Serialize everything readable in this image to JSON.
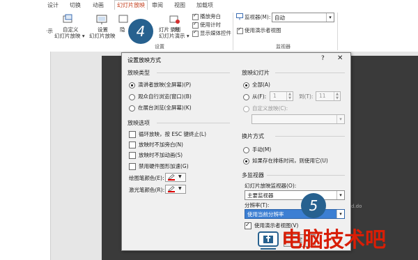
{
  "ribbon": {
    "tabs": [
      "设计",
      "切换",
      "动画",
      "幻灯片放映",
      "审阅",
      "视图",
      "加载项"
    ],
    "custom_show_left": "·示",
    "custom_show": [
      "自定义",
      "幻灯片放映 ▾"
    ],
    "setup_show": [
      "设置",
      "幻灯片放映"
    ],
    "hide_slide": [
      "隐"
    ],
    "rehearse_label": "灯片 · 时",
    "record": [
      "录制",
      "幻灯片演示 ▾"
    ],
    "checks": [
      "播放旁白",
      "使用计时",
      "显示媒体控件"
    ],
    "group_setup": "设置",
    "monitor_label": "监视器(M):",
    "monitor_value": "自动",
    "presenter_view": "使用演示者视图",
    "group_monitors": "监视器"
  },
  "dialog": {
    "title": "设置放映方式",
    "help": "?",
    "close": "✕",
    "show_type": {
      "header": "放映类型",
      "options": [
        "演讲者放映(全屏幕)(P)",
        "观众自行浏览(窗口)(B)",
        "在展台浏览(全屏幕)(K)"
      ]
    },
    "show_options": {
      "header": "放映选项",
      "options": [
        "循环放映，按 ESC 键终止(L)",
        "放映时不加旁白(N)",
        "放映时不加动画(S)",
        "禁用硬件图形加速(G)"
      ],
      "pen_color": "绘图笔颜色(E):",
      "laser_color": "激光笔颜色(R):"
    },
    "show_slides": {
      "header": "放映幻灯片",
      "all": "全部(A)",
      "from": "从(F):",
      "from_value": "1",
      "to": "到(T):",
      "to_value": "11",
      "custom": "自定义放映(C):"
    },
    "advance": {
      "header": "换片方式",
      "manual": "手动(M)",
      "timings": "如果存在排练时间，则使用它(U)"
    },
    "multi_monitor": {
      "header": "多监视器",
      "monitor_label": "幻灯片放映监视器(O):",
      "monitor_value": "主要监视器",
      "resolution_label": "分辨率(T):",
      "resolution_value": "使用当前分辨率",
      "presenter_view": "使用演示者视图(V)"
    },
    "ok_partial": "定"
  },
  "callouts": {
    "step4": "4",
    "step5": "5"
  },
  "watermark": {
    "text": "电脑技术吧",
    "side_text": "d.do"
  },
  "colors": {
    "accent": "#c43e1c",
    "callout": "#27618f",
    "watermark": "#d81e06",
    "pen": "#e00000"
  }
}
